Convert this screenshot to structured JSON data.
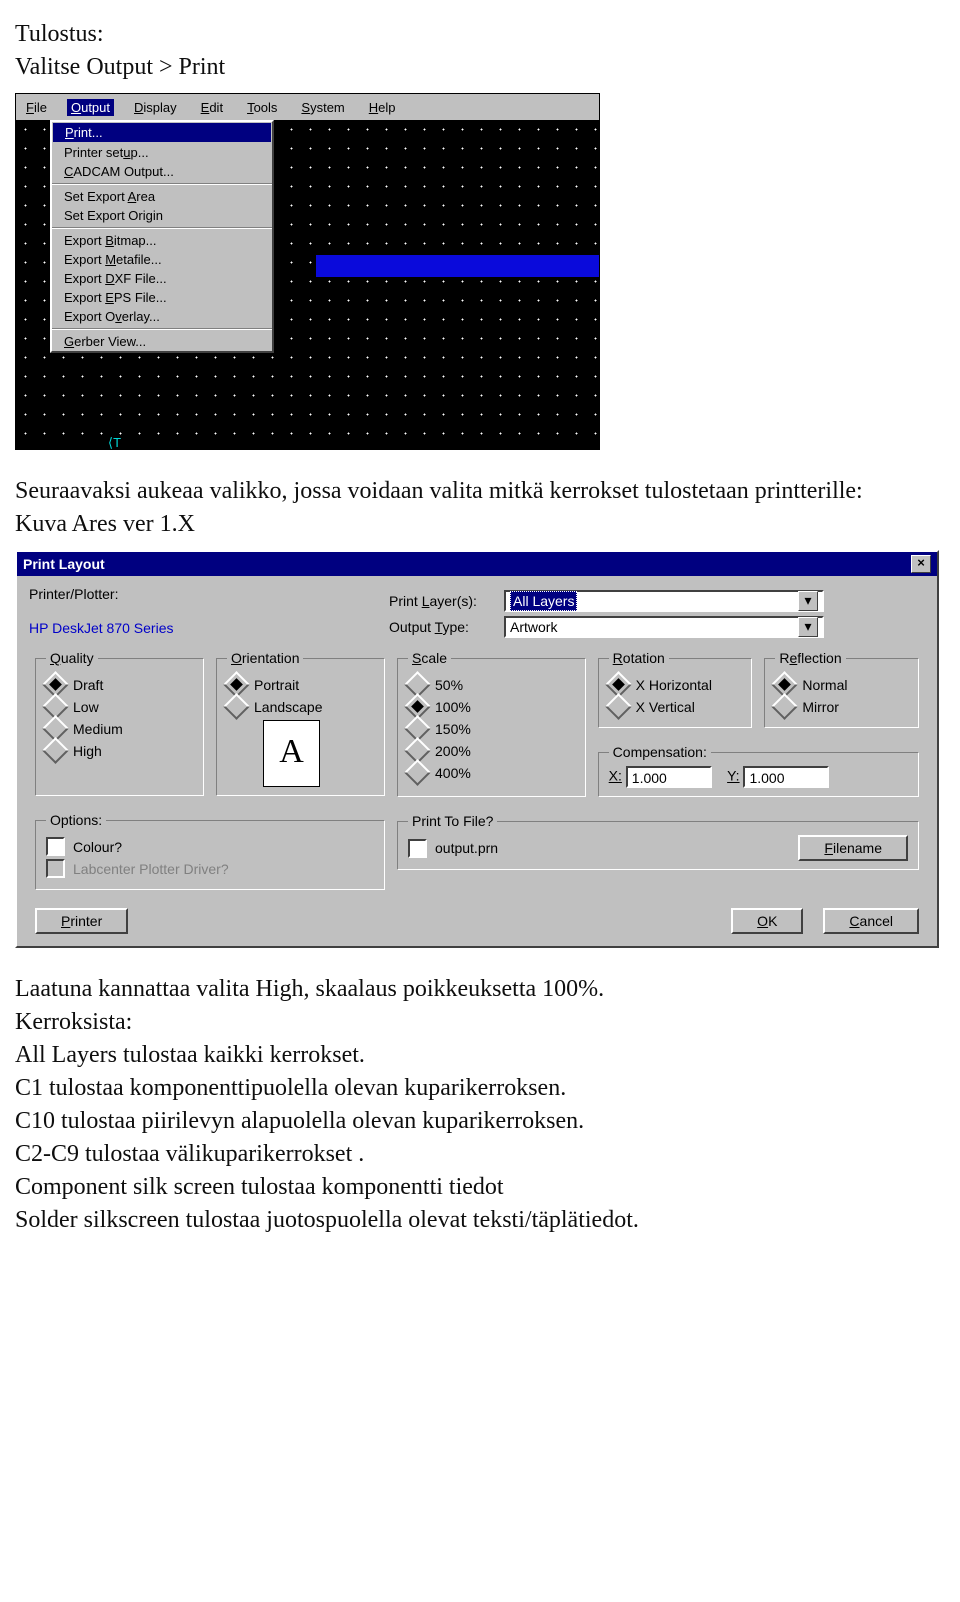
{
  "doc": {
    "title": "Tulostus:",
    "line1": "Valitse Output > Print",
    "line2": "Seuraavaksi aukeaa valikko, jossa voidaan valita mitkä kerrokset tulostetaan printterille:",
    "line3": "Kuva Ares ver 1.X",
    "post1": "Laatuna kannattaa valita High, skaalaus poikkeuksetta 100%.",
    "post2": "Kerroksista:",
    "post3": "All Layers tulostaa kaikki kerrokset.",
    "post4": "C1 tulostaa komponenttipuolella olevan kuparikerroksen.",
    "post5": "C10 tulostaa piirilevyn alapuolella olevan kuparikerroksen.",
    "post6": "C2-C9 tulostaa välikuparikerrokset .",
    "post7": "Component silk screen tulostaa komponentti tiedot",
    "post8": "Solder silkscreen tulostaa juotospuolella olevat teksti/täplätiedot."
  },
  "menubar": {
    "file": "File",
    "output": "Output",
    "display": "Display",
    "edit": "Edit",
    "tools": "Tools",
    "system": "System",
    "help": "Help"
  },
  "dropdown": {
    "print": "Print...",
    "printer_setup": "Printer setup...",
    "cadcam": "CADCAM Output...",
    "set_area": "Set Export Area",
    "set_origin": "Set Export Origin",
    "bitmap": "Export Bitmap...",
    "metafile": "Export Metafile...",
    "dxf": "Export DXF File...",
    "eps": "Export EPS File...",
    "overlay": "Export Overlay...",
    "gerber": "Gerber View..."
  },
  "dlg": {
    "title": "Print Layout",
    "printer_plotter": "Printer/Plotter:",
    "printer_name": "HP DeskJet 870 Series",
    "print_layers_lbl": "Print Layer(s):",
    "print_layers_val": "All Layers",
    "output_type_lbl": "Output Type:",
    "output_type_val": "Artwork",
    "quality": "Quality",
    "orientation": "Orientation",
    "scale": "Scale",
    "rotation": "Rotation",
    "reflection": "Reflection",
    "draft": "Draft",
    "low": "Low",
    "medium": "Medium",
    "high": "High",
    "portrait": "Portrait",
    "landscape": "Landscape",
    "s50": "50%",
    "s100": "100%",
    "s150": "150%",
    "s200": "200%",
    "s400": "400%",
    "xh": "X Horizontal",
    "xv": "X Vertical",
    "normal": "Normal",
    "mirror": "Mirror",
    "compensation": "Compensation:",
    "x": "X:",
    "y": "Y:",
    "xval": "1.000",
    "yval": "1.000",
    "options": "Options:",
    "colour": "Colour?",
    "labcenter": "Labcenter Plotter Driver?",
    "ptf": "Print To File?",
    "outputprn": "output.prn",
    "filename": "Filename",
    "printer_btn": "Printer",
    "ok": "OK",
    "cancel": "Cancel",
    "page_letter": "A"
  }
}
